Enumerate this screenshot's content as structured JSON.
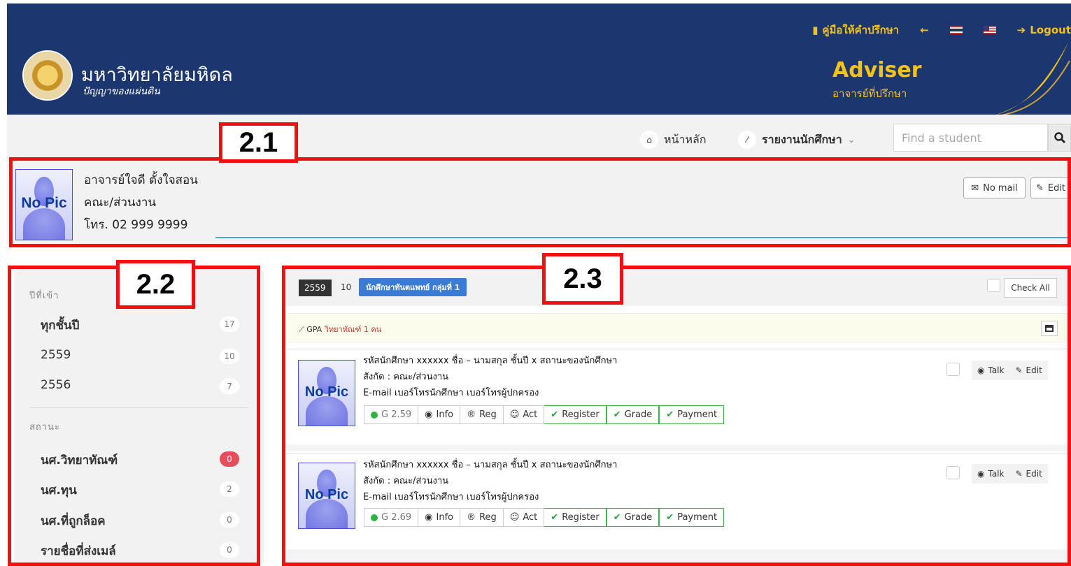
{
  "header": {
    "links": [
      {
        "icon": "book-icon",
        "label": "คู่มือให้คำปรึกษา"
      },
      {
        "icon": "arrow-left-icon",
        "label": ""
      },
      {
        "icon": "flag-th-icon",
        "label": ""
      },
      {
        "icon": "flag-us-icon",
        "label": ""
      },
      {
        "icon": "logout-icon",
        "label": "Logout"
      }
    ],
    "university_name": "มหาวิทยาลัยมหิดล",
    "university_motto": "ปัญญาของแผ่นดิน",
    "app_title": "Adviser",
    "app_subtitle": "อาจารย์ที่ปรึกษา"
  },
  "nav": {
    "home_label": "หน้าหลัก",
    "report_label": "รายงานนักศึกษา",
    "search_placeholder": "Find a student"
  },
  "profile": {
    "photo_text": "No Pic",
    "name": "อาจารย์ใจดี  ตั้งใจสอน",
    "department": "คณะ/ส่วนงาน",
    "phone": "โทร. 02 999 9999",
    "mail_button": "No mail",
    "edit_button": "Edit"
  },
  "sidebar": {
    "year_heading": "ปีที่เข้า",
    "years": [
      {
        "label": "ทุกชั้นปี",
        "count": "17",
        "active": true
      },
      {
        "label": "2559",
        "count": "10"
      },
      {
        "label": "2556",
        "count": "7"
      }
    ],
    "status_heading": "สถานะ",
    "statuses": [
      {
        "label": "นศ.วิทยาทัณฑ์",
        "count": "0",
        "highlight": true
      },
      {
        "label": "นศ.ทุน",
        "count": "2"
      },
      {
        "label": "นศ.ที่ถูกล็อค",
        "count": "0"
      },
      {
        "label": "รายชื่อที่ส่งเมล์",
        "count": "0"
      }
    ]
  },
  "main": {
    "filter_year": "2559",
    "filter_count": "10",
    "filter_group": "นักศึกษาทันตแพทย์ กลุ่มที่ 1",
    "check_all": "Check All",
    "gpa_label": "GPA",
    "gpa_note": "วิทยาทัณฑ์ 1 คน",
    "students": [
      {
        "photo_text": "No Pic",
        "line1": "รหัสนักศึกษา xxxxxx  ชื่อ – นามสกุล  ชั้นปี x  สถานะของนักศึกษา",
        "line2": "สังกัด : คณะ/ส่วนงาน",
        "line3": "E-mail  เบอร์โทรนักศึกษา  เบอร์โทรผู้ปกครอง",
        "gpa": "G 2.59",
        "info": "Info",
        "reg": "Reg",
        "act": "Act",
        "register": "Register",
        "grade": "Grade",
        "payment": "Payment",
        "talk": "Talk",
        "edit": "Edit"
      },
      {
        "photo_text": "No Pic",
        "line1": "รหัสนักศึกษา xxxxxx  ชื่อ – นามสกุล  ชั้นปี x  สถานะของนักศึกษา",
        "line2": "สังกัด : คณะ/ส่วนงาน",
        "line3": "E-mail  เบอร์โทรนักศึกษา  เบอร์โทรผู้ปกครอง",
        "gpa": "G 2.69",
        "info": "Info",
        "reg": "Reg",
        "act": "Act",
        "register": "Register",
        "grade": "Grade",
        "payment": "Payment",
        "talk": "Talk",
        "edit": "Edit"
      }
    ]
  },
  "annotations": {
    "label_1": "2.1",
    "label_2": "2.2",
    "label_3": "2.3"
  },
  "colors": {
    "header_bg": "#1c3770",
    "accent_gold": "#f4c219",
    "annotation_red": "#ef1111",
    "primary_blue": "#3a7bd5",
    "success_green": "#2fb344",
    "danger_red": "#e84d5e"
  }
}
